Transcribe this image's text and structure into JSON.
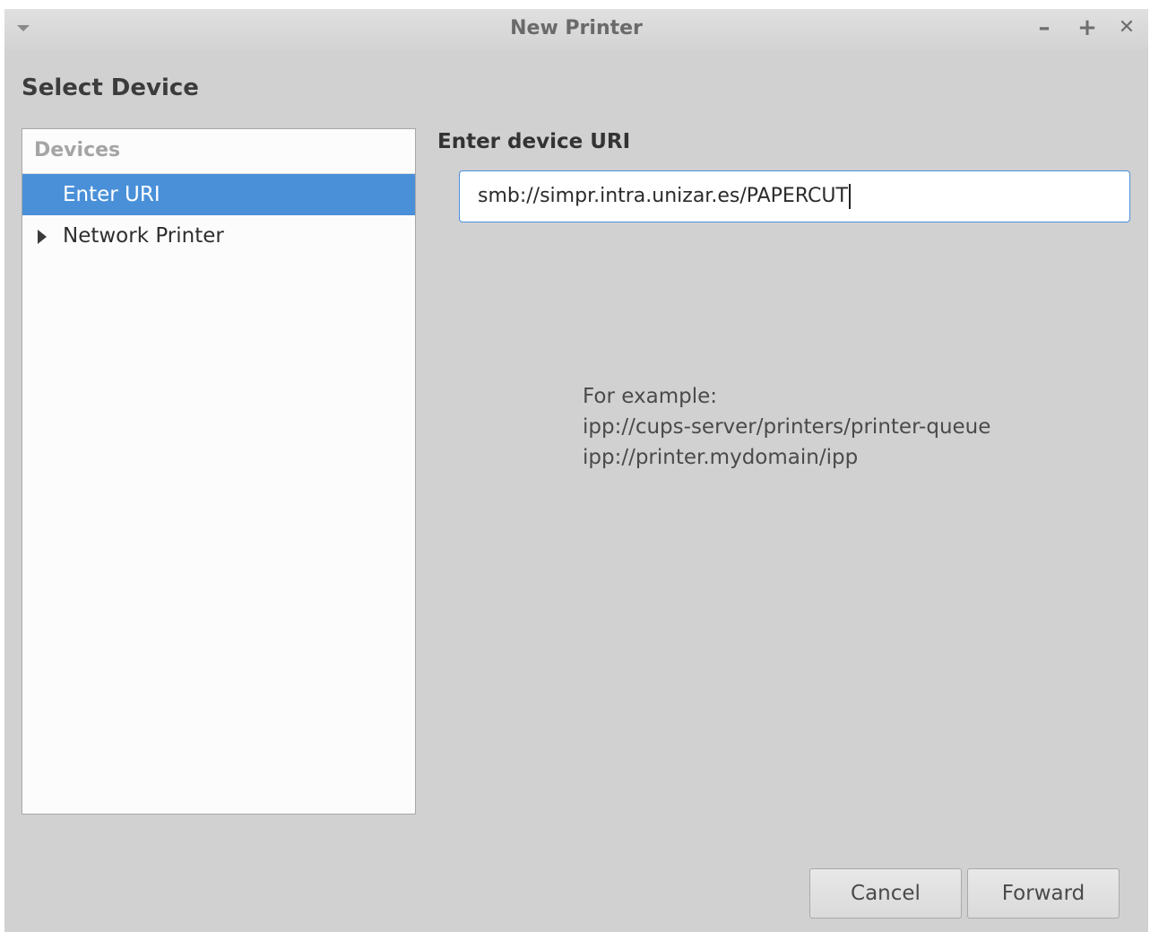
{
  "window": {
    "title": "New Printer",
    "menu_icon": "chevron-down-icon",
    "minimize_glyph": "–",
    "maximize_glyph": "+",
    "close_glyph": "✕"
  },
  "page": {
    "heading": "Select Device"
  },
  "devices": {
    "header": "Devices",
    "items": [
      {
        "label": "Enter URI",
        "selected": true,
        "expandable": false
      },
      {
        "label": "Network Printer",
        "selected": false,
        "expandable": true
      }
    ]
  },
  "uri": {
    "label": "Enter device URI",
    "value": "smb://simpr.intra.unizar.es/PAPERCUT"
  },
  "example": {
    "heading": "For example:",
    "line1": "ipp://cups-server/printers/printer-queue",
    "line2": "ipp://printer.mydomain/ipp"
  },
  "buttons": {
    "cancel": "Cancel",
    "forward": "Forward"
  },
  "colors": {
    "selection": "#4a90d9",
    "window_bg": "#d1d1d1"
  }
}
